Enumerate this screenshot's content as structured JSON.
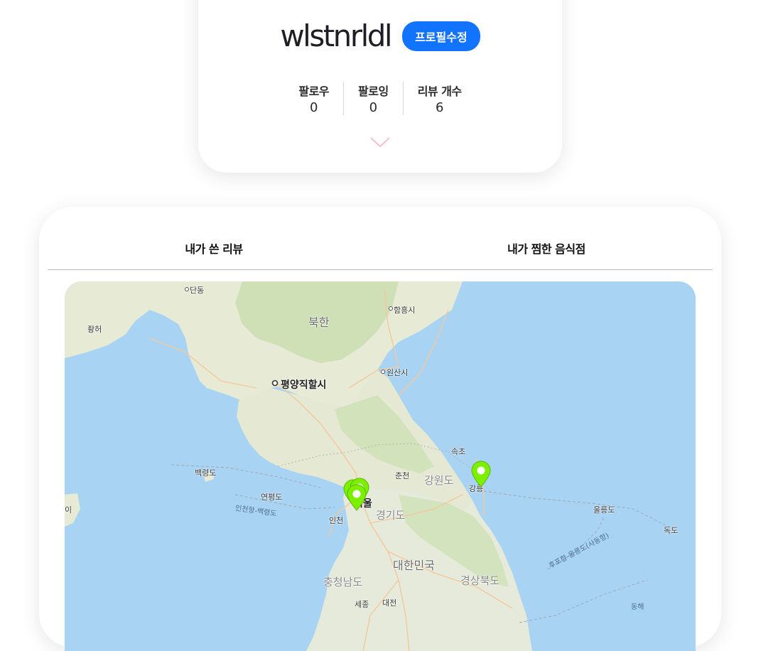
{
  "profile": {
    "username": "wlstnrldl",
    "edit_button": "프로필수정",
    "stats": [
      {
        "label": "팔로우",
        "value": "0"
      },
      {
        "label": "팔로잉",
        "value": "0"
      },
      {
        "label": "리뷰 개수",
        "value": "6"
      }
    ],
    "expand_icon": "chevron-down-icon"
  },
  "tabs": [
    {
      "label": "내가 쓴 리뷰"
    },
    {
      "label": "내가 찜한 음식점"
    }
  ],
  "map": {
    "marker_color": "#7cf000",
    "sea_color": "#a9d3f2",
    "land_color": "#e8ecd8",
    "labels": {
      "dandong": "단동",
      "hamheung": "함흥시",
      "hwanghae": "좡허",
      "north_korea": "북한",
      "wonsan": "원산시",
      "pyongyang": "평양직할시",
      "sokcho": "속초",
      "chuncheon": "춘천",
      "gangwon": "강원도",
      "gangneung": "강릉",
      "baengnyeong": "백령도",
      "yeonpyeong": "연평도",
      "incheon_route": "인천항-백령도",
      "incheon": "인천",
      "seoul": "서울",
      "gyeonggi": "경기도",
      "ulleung": "울릉도",
      "dokdo": "독도",
      "hupo_route": "후포항-울릉도(사동항)",
      "left_edge": "이",
      "korea": "대한민국",
      "chungnam": "충청남도",
      "gyeongbuk": "경상북도",
      "sejong": "세종",
      "daejeon": "대전",
      "donghae": "동해"
    }
  }
}
